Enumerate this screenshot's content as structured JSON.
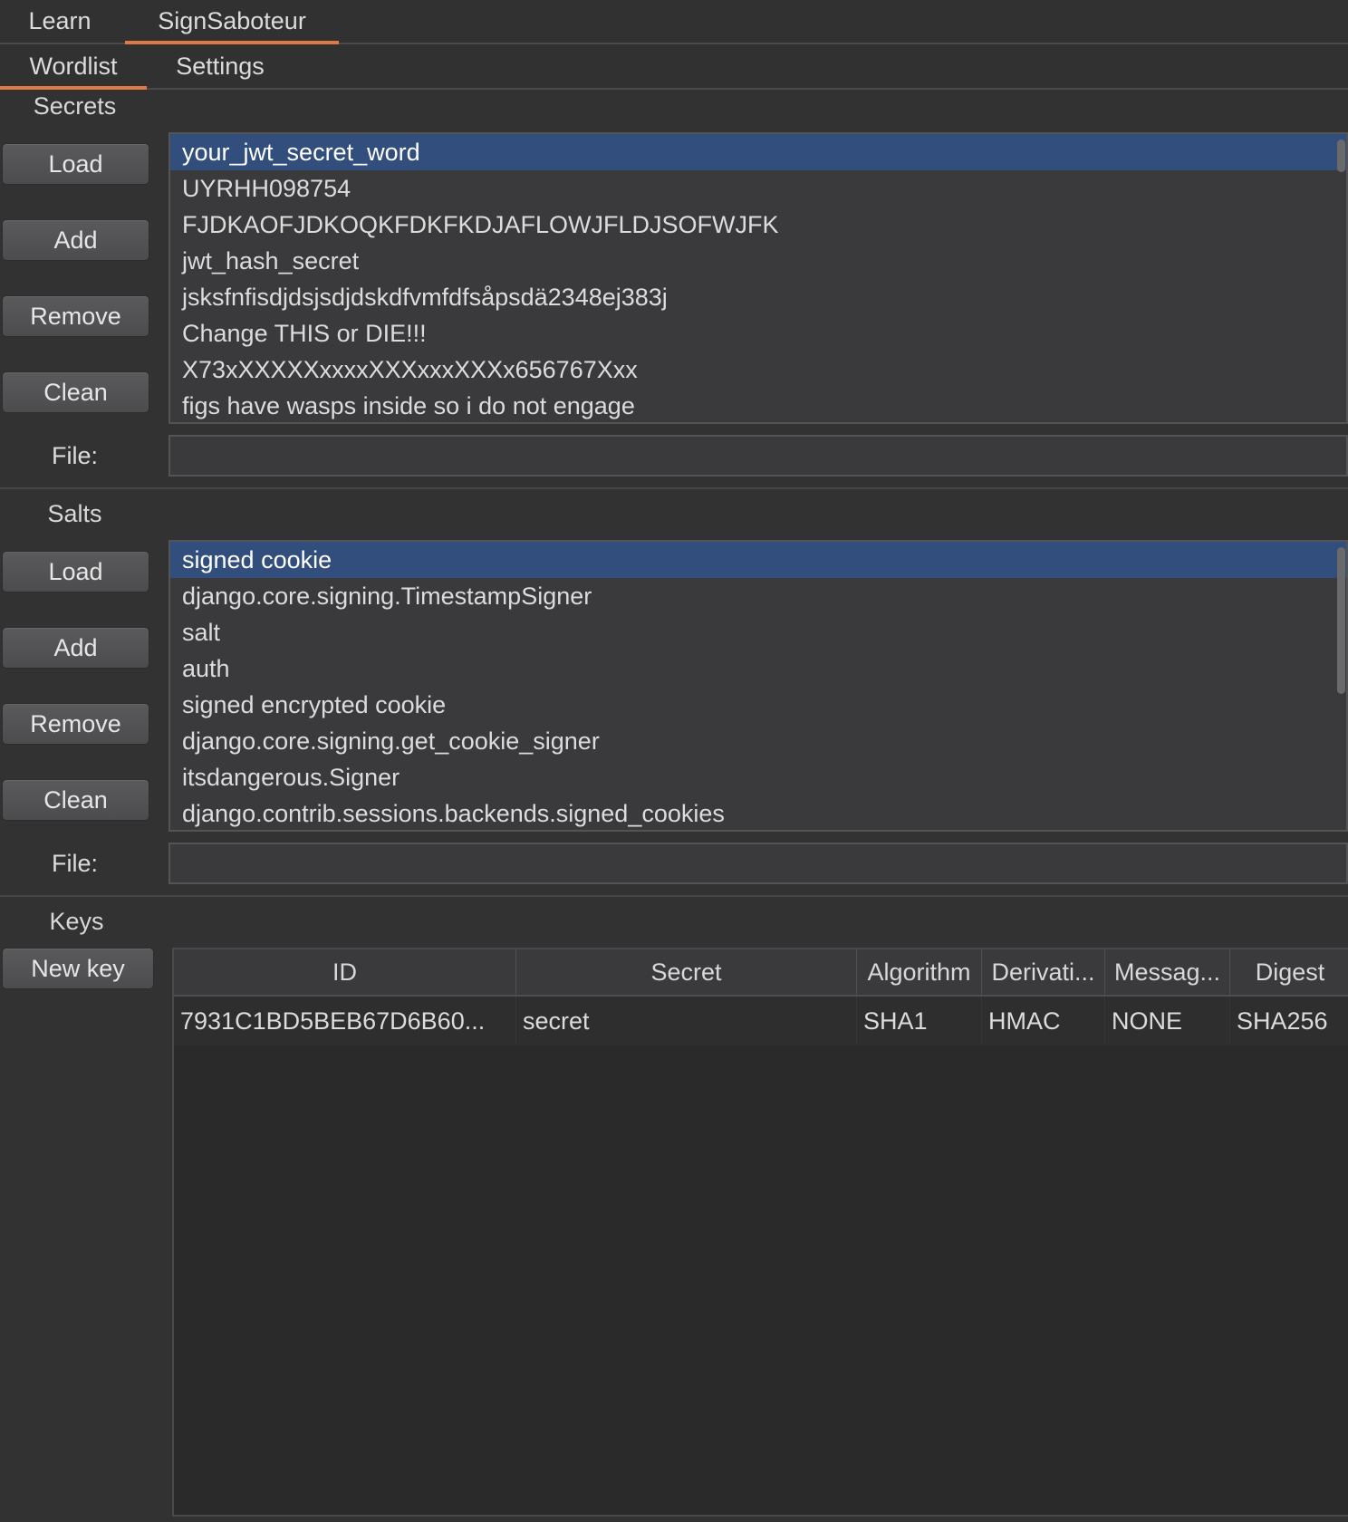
{
  "tabs": {
    "learn": "Learn",
    "signsaboteur": "SignSaboteur"
  },
  "subtabs": {
    "wordlist": "Wordlist",
    "settings": "Settings"
  },
  "secrets": {
    "label": "Secrets",
    "buttons": {
      "load": "Load",
      "add": "Add",
      "remove": "Remove",
      "clean": "Clean"
    },
    "items": [
      "your_jwt_secret_word",
      "UYRHH098754",
      "FJDKAOFJDKOQKFDKFKDJAFLOWJFLDJSOFWJFK",
      "jwt_hash_secret",
      "jsksfnfisdjdsjsdjdskdfvmfdfsåpsdä2348ej383j",
      "Change THIS or DIE!!!",
      "X73xXXXXXxxxxXXXxxxXXXx656767Xxx",
      "figs have wasps inside so i do not engage"
    ],
    "file_label": "File:",
    "file_value": ""
  },
  "salts": {
    "label": "Salts",
    "buttons": {
      "load": "Load",
      "add": "Add",
      "remove": "Remove",
      "clean": "Clean"
    },
    "items": [
      "signed cookie",
      "django.core.signing.TimestampSigner",
      "salt",
      "auth",
      "signed encrypted cookie",
      "django.core.signing.get_cookie_signer",
      "itsdangerous.Signer",
      "django.contrib.sessions.backends.signed_cookies"
    ],
    "file_label": "File:",
    "file_value": ""
  },
  "keys": {
    "label": "Keys",
    "new_key_button": "New key",
    "columns": [
      "ID",
      "Secret",
      "Algorithm",
      "Derivati...",
      "Messag...",
      "Digest"
    ],
    "rows": [
      [
        "7931C1BD5BEB67D6B60...",
        "secret",
        "SHA1",
        "HMAC",
        "NONE",
        "SHA256"
      ]
    ]
  }
}
